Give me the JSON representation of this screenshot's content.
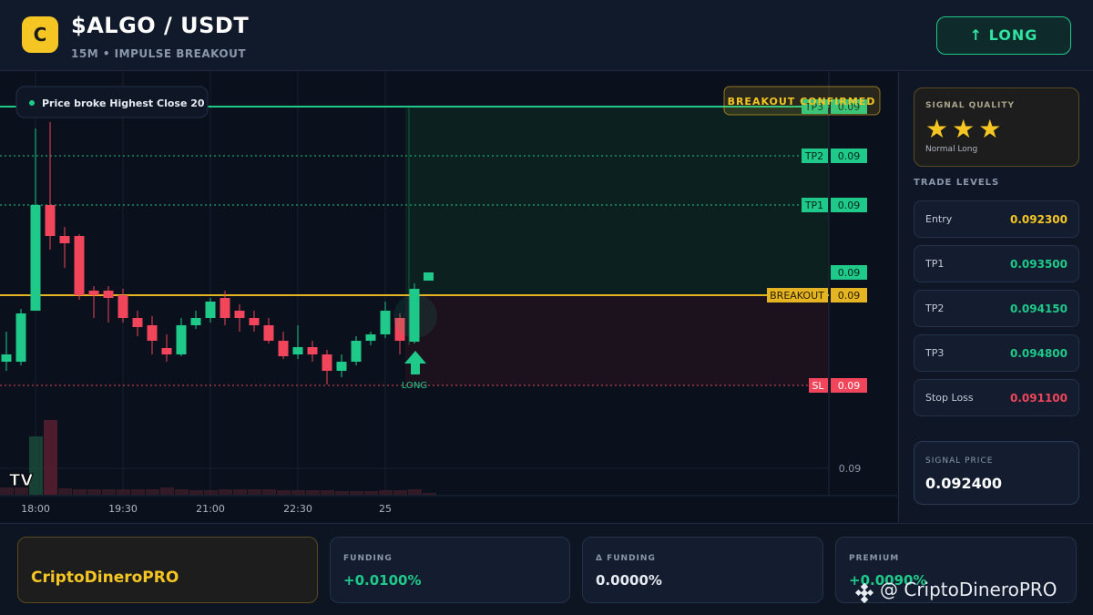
{
  "header": {
    "logo_letter": "C",
    "pair": "$ALGO / USDT",
    "subtitle": "15M • IMPULSE BREAKOUT",
    "long_button": "↑ LONG"
  },
  "chart": {
    "alert_text": "Price broke Highest Close 20",
    "confirm_badge": "BREAKOUT CONFIRMED",
    "long_marker_label": "LONG",
    "levels": [
      {
        "label": "TP3",
        "value": "0.09"
      },
      {
        "label": "TP2",
        "value": "0.09"
      },
      {
        "label": "TP1",
        "value": "0.09"
      },
      {
        "label": "",
        "value": "0.09"
      },
      {
        "label": "BREAKOUT",
        "value": "0.09"
      },
      {
        "label": "SL",
        "value": "0.09"
      }
    ],
    "volume_axis_label": "0.09",
    "time_labels": [
      "18:00",
      "19:30",
      "21:00",
      "22:30",
      "25"
    ],
    "tv_logo": "TV",
    "colors": {
      "up": "#1ec98a",
      "down": "#f0455a",
      "breakout": "#e5b422",
      "tp": "#1ec98a",
      "sl": "#f0455a"
    }
  },
  "panel": {
    "quality_title": "SIGNAL QUALITY",
    "stars": "★★★",
    "quality_sub": "Normal Long",
    "levels_title": "TRADE LEVELS",
    "levels": [
      {
        "name": "Entry",
        "value": "0.092300",
        "color": "#f5c623"
      },
      {
        "name": "TP1",
        "value": "0.093500",
        "color": "#1ec98a"
      },
      {
        "name": "TP2",
        "value": "0.094150",
        "color": "#1ec98a"
      },
      {
        "name": "TP3",
        "value": "0.094800",
        "color": "#1ec98a"
      },
      {
        "name": "Stop Loss",
        "value": "0.091100",
        "color": "#f0455a"
      }
    ],
    "signal_price_label": "SIGNAL PRICE",
    "signal_price": "0.092400"
  },
  "footer": {
    "brand": "CriptoDineroPRO",
    "funding_label": "FUNDING",
    "funding_value": "+0.0100%",
    "dfunding_label": "Δ FUNDING",
    "dfunding_value": "0.0000%",
    "premium_label": "PREMIUM",
    "premium_value": "+0.0090%",
    "watermark": "@ CriptoDineroPRO"
  }
}
